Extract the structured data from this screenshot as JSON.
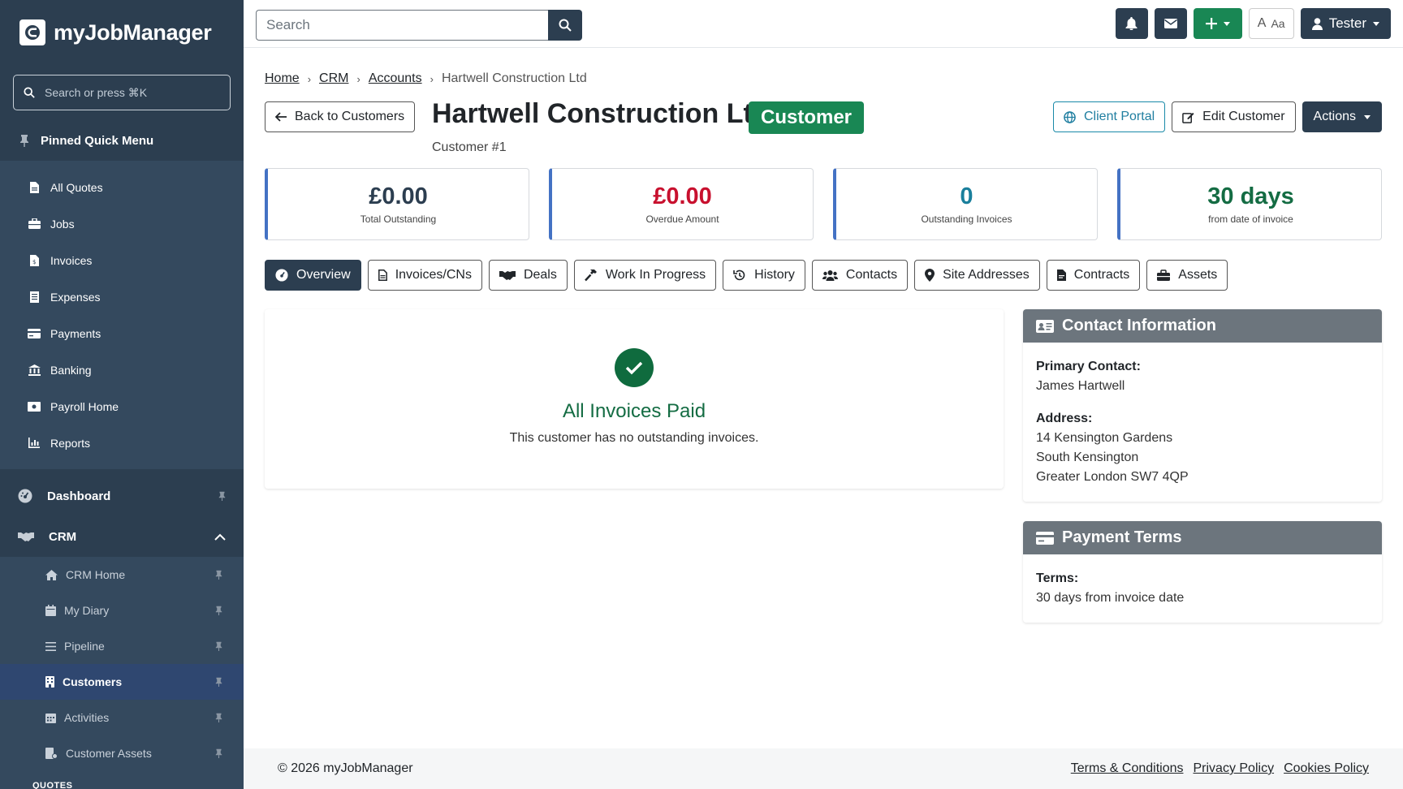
{
  "brand": {
    "name": "myJobManager"
  },
  "sidebar": {
    "search_placeholder": "Search or press ⌘K",
    "pinned_label": "Pinned Quick Menu",
    "quick_items": [
      {
        "label": "All Quotes",
        "icon": "file-icon"
      },
      {
        "label": "Jobs",
        "icon": "briefcase-icon"
      },
      {
        "label": "Invoices",
        "icon": "invoice-icon"
      },
      {
        "label": "Expenses",
        "icon": "receipt-icon"
      },
      {
        "label": "Payments",
        "icon": "card-icon"
      },
      {
        "label": "Banking",
        "icon": "bank-icon"
      },
      {
        "label": "Payroll Home",
        "icon": "money-icon"
      },
      {
        "label": "Reports",
        "icon": "chart-icon"
      }
    ],
    "dashboard_label": "Dashboard",
    "crm_label": "CRM",
    "crm_items": [
      {
        "label": "CRM Home"
      },
      {
        "label": "My Diary"
      },
      {
        "label": "Pipeline"
      },
      {
        "label": "Customers"
      },
      {
        "label": "Activities"
      },
      {
        "label": "Customer Assets"
      }
    ],
    "section_quotes": "QUOTES"
  },
  "topbar": {
    "search_placeholder": "Search",
    "font_toggle": "Aa",
    "user_label": "Tester"
  },
  "breadcrumb": {
    "home": "Home",
    "crm": "CRM",
    "accounts": "Accounts",
    "current": "Hartwell Construction Ltd"
  },
  "header": {
    "back_label": "Back to Customers",
    "title": "Hartwell Construction Ltd",
    "badge": "Customer",
    "subtitle": "Customer #1",
    "portal_label": "Client Portal",
    "edit_label": "Edit Customer",
    "actions_label": "Actions"
  },
  "stats": [
    {
      "value": "£0.00",
      "label": "Total Outstanding",
      "color": "#2c3e50"
    },
    {
      "value": "£0.00",
      "label": "Overdue Amount",
      "color": "#c8102e"
    },
    {
      "value": "0",
      "label": "Outstanding Invoices",
      "color": "#1a7f9c"
    },
    {
      "value": "30 days",
      "label": "from date of invoice",
      "color": "#146c43"
    }
  ],
  "tabs": [
    {
      "label": "Overview"
    },
    {
      "label": "Invoices/CNs"
    },
    {
      "label": "Deals"
    },
    {
      "label": "Work In Progress"
    },
    {
      "label": "History"
    },
    {
      "label": "Contacts"
    },
    {
      "label": "Site Addresses"
    },
    {
      "label": "Contracts"
    },
    {
      "label": "Assets"
    }
  ],
  "overview": {
    "title": "All Invoices Paid",
    "text": "This customer has no outstanding invoices."
  },
  "contact": {
    "heading": "Contact Information",
    "primary_label": "Primary Contact:",
    "primary_name": "James Hartwell",
    "address_label": "Address:",
    "address_line1": "14 Kensington Gardens",
    "address_line2": "South Kensington",
    "address_line3": "Greater London SW7 4QP"
  },
  "terms": {
    "heading": "Payment Terms",
    "terms_label": "Terms:",
    "terms_value": "30 days from invoice date"
  },
  "footer": {
    "copyright": "© 2026 myJobManager",
    "terms": "Terms & Conditions",
    "privacy": "Privacy Policy",
    "cookies": "Cookies Policy"
  },
  "colors": {
    "sidebar": "#2c3e50",
    "accent_green": "#198754",
    "danger": "#c8102e",
    "info": "#1a7f9c"
  }
}
